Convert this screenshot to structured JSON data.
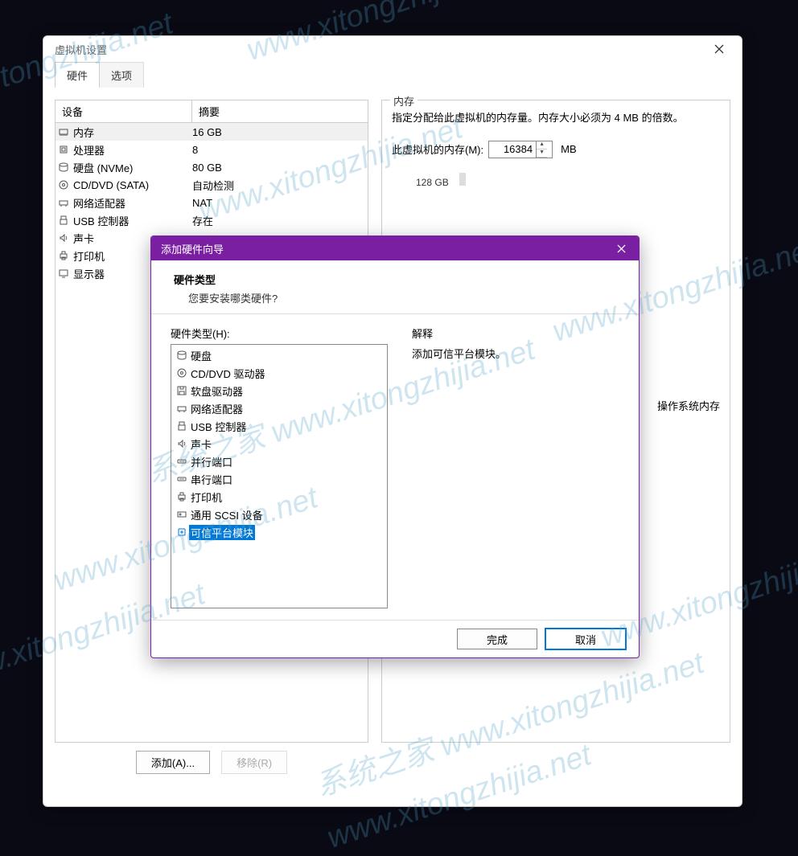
{
  "watermarks": [
    "系统之家 www.xitongzhijia.net",
    "www.xitongzhijia.net"
  ],
  "settings": {
    "title": "虚拟机设置",
    "tabs": {
      "hardware": "硬件",
      "options": "选项"
    },
    "columns": {
      "device": "设备",
      "summary": "摘要"
    },
    "devices": [
      {
        "icon": "memory",
        "name": "内存",
        "summary": "16 GB",
        "selected": true
      },
      {
        "icon": "cpu",
        "name": "处理器",
        "summary": "8"
      },
      {
        "icon": "disk",
        "name": "硬盘 (NVMe)",
        "summary": "80 GB"
      },
      {
        "icon": "cd",
        "name": "CD/DVD (SATA)",
        "summary": "自动检测"
      },
      {
        "icon": "net",
        "name": "网络适配器",
        "summary": "NAT"
      },
      {
        "icon": "usb",
        "name": "USB 控制器",
        "summary": "存在"
      },
      {
        "icon": "sound",
        "name": "声卡",
        "summary": ""
      },
      {
        "icon": "printer",
        "name": "打印机",
        "summary": ""
      },
      {
        "icon": "display",
        "name": "显示器",
        "summary": ""
      }
    ],
    "add_btn": "添加(A)...",
    "remove_btn": "移除(R)"
  },
  "memory_panel": {
    "title": "内存",
    "desc": "指定分配给此虚拟机的内存量。内存大小必须为 4 MB 的倍数。",
    "label": "此虚拟机的内存(M):",
    "value": "16384",
    "unit": "MB",
    "slider_tick": "128 GB",
    "guest_note": "操作系统内存"
  },
  "wizard": {
    "title": "添加硬件向导",
    "header_title": "硬件类型",
    "header_sub": "您要安装哪类硬件?",
    "list_label": "硬件类型(H):",
    "explain_label": "解释",
    "explain_text": "添加可信平台模块。",
    "items": [
      {
        "icon": "disk",
        "label": "硬盘"
      },
      {
        "icon": "cd",
        "label": "CD/DVD 驱动器"
      },
      {
        "icon": "floppy",
        "label": "软盘驱动器"
      },
      {
        "icon": "net",
        "label": "网络适配器"
      },
      {
        "icon": "usb",
        "label": "USB 控制器"
      },
      {
        "icon": "sound",
        "label": "声卡"
      },
      {
        "icon": "port",
        "label": "并行端口"
      },
      {
        "icon": "port",
        "label": "串行端口"
      },
      {
        "icon": "printer",
        "label": "打印机"
      },
      {
        "icon": "scsi",
        "label": "通用 SCSI 设备"
      },
      {
        "icon": "tpm",
        "label": "可信平台模块",
        "selected": true
      }
    ],
    "finish_btn": "完成",
    "cancel_btn": "取消"
  }
}
